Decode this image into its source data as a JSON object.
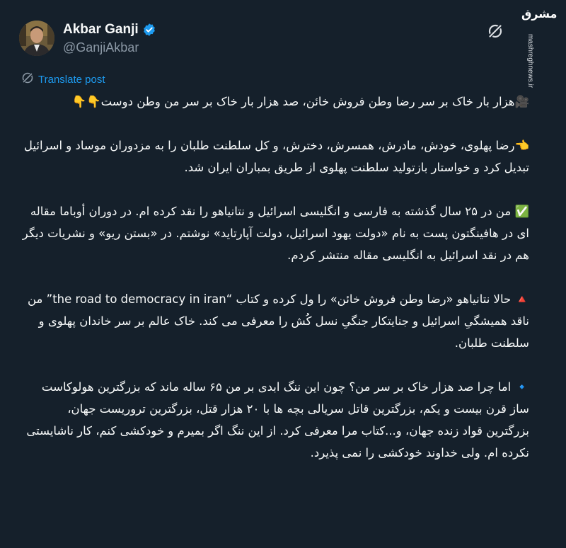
{
  "author": {
    "display_name": "Akbar Ganji",
    "handle": "@GanjiAkbar",
    "verified": true
  },
  "watermark": {
    "logo": "مشرق",
    "url": "mashreghnews.ir"
  },
  "translate_label": "Translate post",
  "colors": {
    "background": "#15202b",
    "text": "#f7f9f9",
    "secondary": "#8b98a5",
    "accent": "#1d9bf0"
  },
  "post": {
    "paragraphs": [
      "🎥هزار بار خاک بر سر رضا وطن فروش خائن، صد هزار بار خاک بر سر من وطن دوست👇👇",
      "👈رضا پهلوی، خودش، مادرش، همسرش، دخترش، و کل سلطنت طلبان را به مزدوران موساد و اسرائیل تبدیل کرد و خواستار بازتولید سلطنت پهلوی از طریق بمباران ایران شد.",
      "✅ من در ۲۵ سال گذشته به فارسی و انگلیسی اسرائیل و نتانیاهو را نقد کرده ام. در دوران أوباما مقاله ای در هافینگتون پست به نام «دولت یهود اسرائیل، دولت آپارتاید» نوشتم. در «بستن ریو» و نشریات دیگر هم در نقد اسرائیل به انگلیسی مقاله منتشر کردم.",
      "🔺 حالا نتانیاهو «رضا وطن فروش خائن» را ول کرده و کتاب “the road to democracy in iran” من ناقد همیشگیِ اسرائیل و جنایتکار جنگیِ نسل کُش را معرفی می کند. خاک عالم بر سر خاندان پهلوی و سلطنت طلبان.",
      "🔹 اما چرا صد هزار خاک بر سر من؟ چون این ننگ ابدی بر من ۶۵ ساله ماند که بزرگترین هولوکاست ساز قرن بیست و یکم، بزرگترین قاتل سریالی بچه ها با ۲۰ هزار قتل، بزرگترین تروریست جهان، بزرگترین قواد زنده جهان، و...کتاب مرا معرفی کرد. از این ننگ اگر بمیرم و خودکشی کنم، کار ناشایستی نکرده ام. ولی خداوند خودکشی را نمی پذیرد."
    ]
  }
}
